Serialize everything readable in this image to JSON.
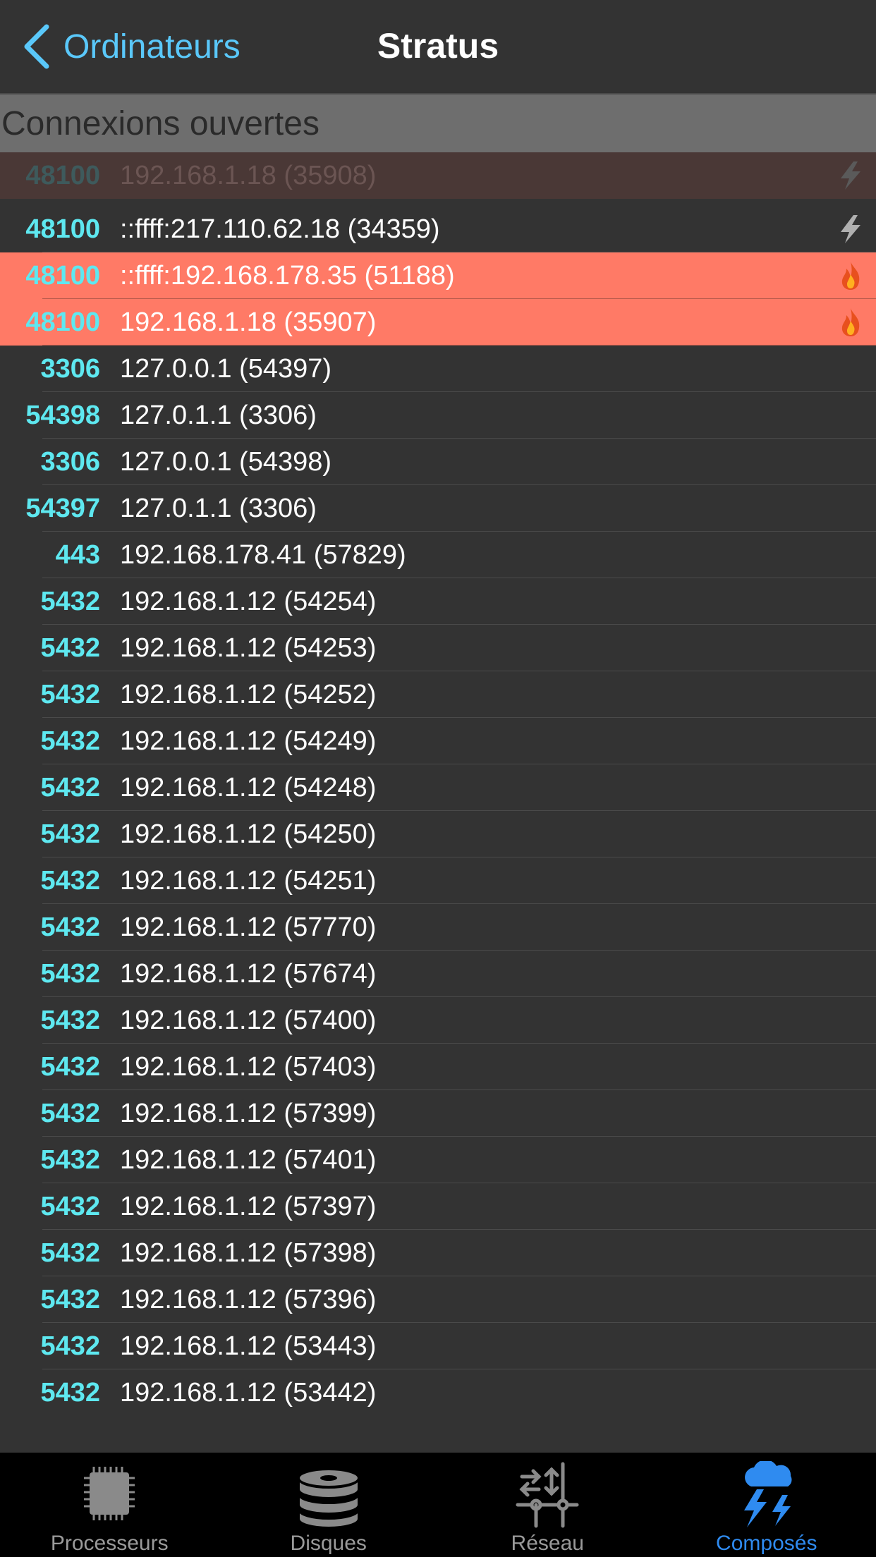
{
  "nav": {
    "back_label": "Ordinateurs",
    "title": "Stratus"
  },
  "section": {
    "title": "Connexions ouvertes"
  },
  "rows": [
    {
      "port": "48100",
      "addr": "192.168.1.18 (35908)",
      "state": "dim",
      "badge": "lightning-icon"
    },
    {
      "port": "48100",
      "addr": "::ffff:217.110.62.18 (34359)",
      "state": "normal",
      "badge": "lightning-icon"
    },
    {
      "port": "48100",
      "addr": "::ffff:192.168.178.35 (51188)",
      "state": "hot",
      "badge": "flame-icon"
    },
    {
      "port": "48100",
      "addr": "192.168.1.18 (35907)",
      "state": "hot",
      "badge": "flame-icon"
    },
    {
      "port": "3306",
      "addr": "127.0.0.1 (54397)",
      "state": "normal"
    },
    {
      "port": "54398",
      "addr": "127.0.1.1 (3306)",
      "state": "normal"
    },
    {
      "port": "3306",
      "addr": "127.0.0.1 (54398)",
      "state": "normal"
    },
    {
      "port": "54397",
      "addr": "127.0.1.1 (3306)",
      "state": "normal"
    },
    {
      "port": "443",
      "addr": "192.168.178.41 (57829)",
      "state": "normal"
    },
    {
      "port": "5432",
      "addr": "192.168.1.12 (54254)",
      "state": "normal"
    },
    {
      "port": "5432",
      "addr": "192.168.1.12 (54253)",
      "state": "normal"
    },
    {
      "port": "5432",
      "addr": "192.168.1.12 (54252)",
      "state": "normal"
    },
    {
      "port": "5432",
      "addr": "192.168.1.12 (54249)",
      "state": "normal"
    },
    {
      "port": "5432",
      "addr": "192.168.1.12 (54248)",
      "state": "normal"
    },
    {
      "port": "5432",
      "addr": "192.168.1.12 (54250)",
      "state": "normal"
    },
    {
      "port": "5432",
      "addr": "192.168.1.12 (54251)",
      "state": "normal"
    },
    {
      "port": "5432",
      "addr": "192.168.1.12 (57770)",
      "state": "normal"
    },
    {
      "port": "5432",
      "addr": "192.168.1.12 (57674)",
      "state": "normal"
    },
    {
      "port": "5432",
      "addr": "192.168.1.12 (57400)",
      "state": "normal"
    },
    {
      "port": "5432",
      "addr": "192.168.1.12 (57403)",
      "state": "normal"
    },
    {
      "port": "5432",
      "addr": "192.168.1.12 (57399)",
      "state": "normal"
    },
    {
      "port": "5432",
      "addr": "192.168.1.12 (57401)",
      "state": "normal"
    },
    {
      "port": "5432",
      "addr": "192.168.1.12 (57397)",
      "state": "normal"
    },
    {
      "port": "5432",
      "addr": "192.168.1.12 (57398)",
      "state": "normal"
    },
    {
      "port": "5432",
      "addr": "192.168.1.12 (57396)",
      "state": "normal"
    },
    {
      "port": "5432",
      "addr": "192.168.1.12 (53443)",
      "state": "normal"
    },
    {
      "port": "5432",
      "addr": "192.168.1.12 (53442)",
      "state": "normal"
    }
  ],
  "tabs": [
    {
      "label": "Processeurs",
      "icon": "cpu-chip-icon",
      "active": false
    },
    {
      "label": "Disques",
      "icon": "disk-stack-icon",
      "active": false
    },
    {
      "label": "Réseau",
      "icon": "network-icon",
      "active": false
    },
    {
      "label": "Composés",
      "icon": "storm-cloud-icon",
      "active": true
    }
  ],
  "colors": {
    "accent": "#5ac8fa",
    "port_text": "#5ee8f0",
    "hot_row": "#ff7a66",
    "active_tab": "#2f8bf0"
  }
}
